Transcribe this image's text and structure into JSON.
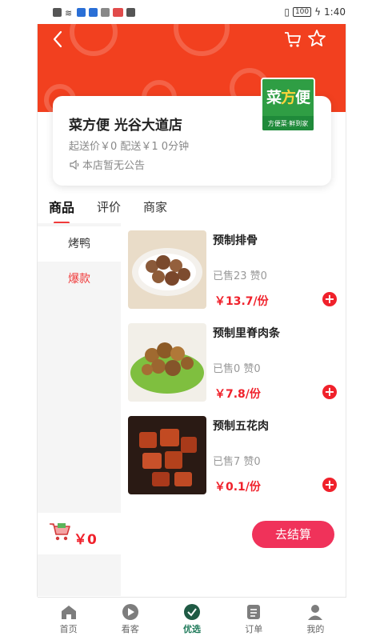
{
  "status_bar": {
    "time": "1:40",
    "battery": "100"
  },
  "header": {
    "brand_color": "#f2401f"
  },
  "store": {
    "name": "菜方便 光谷大道店",
    "delivery_info": "起送价￥0 配送￥1 0分钟",
    "notice": "本店暂无公告",
    "logo_text_top_1": "菜",
    "logo_text_top_2": "方",
    "logo_text_top_3": "便",
    "logo_text_bottom": "方便菜·鲜到家"
  },
  "tabs": [
    {
      "label": "商品",
      "active": true
    },
    {
      "label": "评价",
      "active": false
    },
    {
      "label": "商家",
      "active": false
    }
  ],
  "categories": [
    {
      "label": "烤鸭"
    },
    {
      "label": "爆款"
    }
  ],
  "products": [
    {
      "name": "预制排骨",
      "stats": "已售23 赞0",
      "price": "￥13.7/份"
    },
    {
      "name": "预制里脊肉条",
      "stats": "已售0 赞0",
      "price": "￥7.8/份"
    },
    {
      "name": "预制五花肉",
      "stats": "已售7 赞0",
      "price": "￥0.1/份"
    }
  ],
  "cart": {
    "total": "￥0",
    "checkout_label": "去结算"
  },
  "bottom_nav": [
    {
      "label": "首页",
      "icon": "home-icon"
    },
    {
      "label": "看客",
      "icon": "play-icon"
    },
    {
      "label": "优选",
      "icon": "check-icon",
      "active": true
    },
    {
      "label": "订单",
      "icon": "list-icon"
    },
    {
      "label": "我的",
      "icon": "user-icon"
    }
  ],
  "colors": {
    "accent_red": "#f0212b",
    "checkout_pink": "#f0325a",
    "nav_active": "#1f7a5a"
  }
}
